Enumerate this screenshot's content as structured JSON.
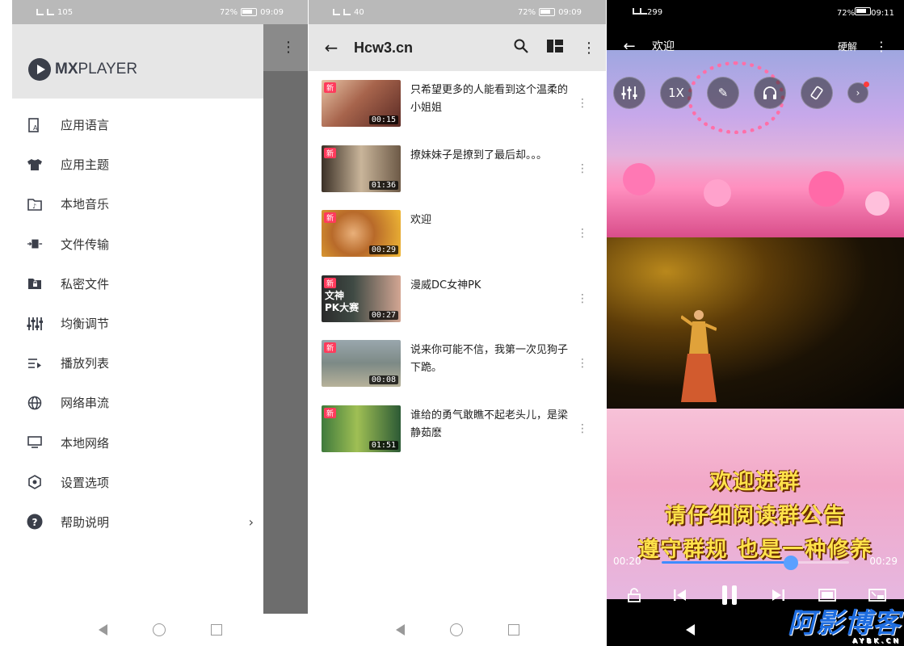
{
  "panel1": {
    "status": {
      "battery": "72%",
      "time": "09:09",
      "net_speed": "105"
    },
    "logo": {
      "mx": "MX",
      "player": "PLAYER"
    },
    "menu": [
      {
        "label": "应用语言",
        "icon": "language-icon"
      },
      {
        "label": "应用主题",
        "icon": "tshirt-icon"
      },
      {
        "label": "本地音乐",
        "icon": "music-folder-icon"
      },
      {
        "label": "文件传输",
        "icon": "file-transfer-icon"
      },
      {
        "label": "私密文件",
        "icon": "lock-folder-icon"
      },
      {
        "label": "均衡调节",
        "icon": "equalizer-icon"
      },
      {
        "label": "播放列表",
        "icon": "playlist-icon"
      },
      {
        "label": "网络串流",
        "icon": "globe-icon"
      },
      {
        "label": "本地网络",
        "icon": "monitor-icon"
      },
      {
        "label": "设置选项",
        "icon": "settings-icon"
      },
      {
        "label": "帮助说明",
        "icon": "help-icon"
      }
    ]
  },
  "panel2": {
    "status": {
      "battery": "72%",
      "time": "09:09",
      "net_speed": "40"
    },
    "title": "Hcw3.cn",
    "videos": [
      {
        "title": "只希望更多的人能看到这个温柔的小姐姐",
        "duration": "00:15",
        "badge": "新",
        "caption": "",
        "color": "#8a4a3a"
      },
      {
        "title": "撩妹妹子是撩到了最后却。。。",
        "duration": "01:36",
        "badge": "新",
        "caption": "",
        "color": "#6b5a48"
      },
      {
        "title": "欢迎",
        "duration": "00:29",
        "badge": "新",
        "caption": "",
        "color": "#c98a2a"
      },
      {
        "title": "漫威DC女神PK",
        "duration": "00:27",
        "badge": "新",
        "caption": "文神\nPK大赛",
        "color": "#2f3a34"
      },
      {
        "title": "说来你可能不信，我第一次见狗子下跪。",
        "duration": "00:08",
        "badge": "新",
        "caption": "",
        "color": "#7a8a88"
      },
      {
        "title": "谁给的勇气敢瞧不起老头儿，是梁静茹麽",
        "duration": "01:51",
        "badge": "新",
        "caption": "",
        "color": "#3e6a3a"
      }
    ]
  },
  "panel3": {
    "status": {
      "battery": "72%",
      "time": "09:11",
      "net_speed": "299"
    },
    "title": "欢迎",
    "decoder": "硬解",
    "tools": {
      "speed": "1X"
    },
    "banner": [
      "欢迎进群",
      "请仔细阅读群公告",
      "遵守群规 也是一种修养"
    ],
    "time_current": "00:20",
    "time_total": "00:29",
    "progress": 0.69,
    "watermark": "阿影博客",
    "watermark_sub": "AYBK.CN"
  },
  "colors": {
    "accent": "#3f8cff",
    "badge": "#ff3b5c",
    "drawer_header": "#e6e6e6"
  }
}
